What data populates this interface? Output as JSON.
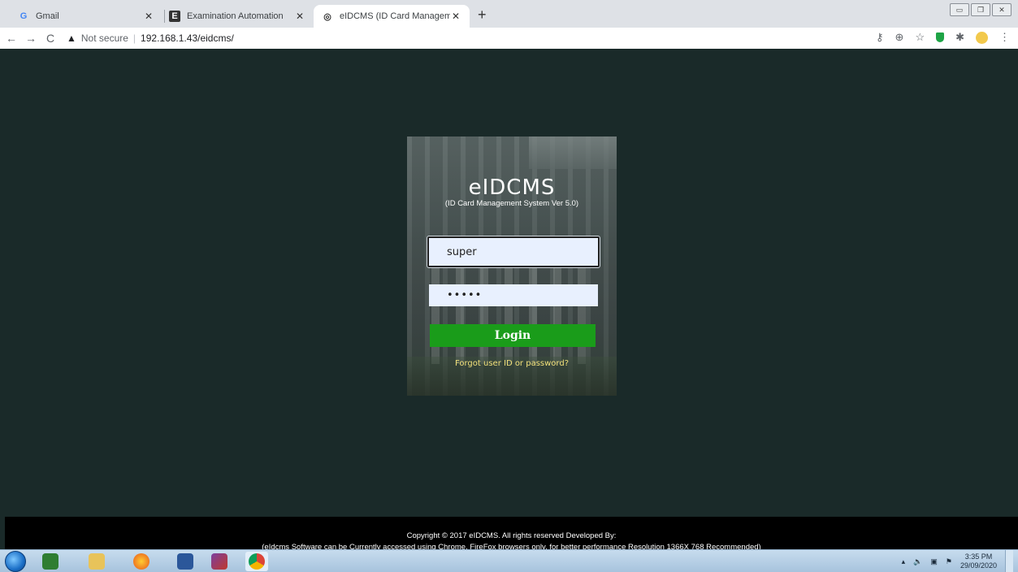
{
  "browser": {
    "tabs": [
      {
        "label": "Gmail",
        "icon": "gmail-icon",
        "icon_glyph": "G"
      },
      {
        "label": "Examination Automation",
        "icon": "app-icon",
        "icon_glyph": "E"
      },
      {
        "label": "eIDCMS (ID Card Management S",
        "icon": "globe-icon",
        "icon_glyph": "◎"
      }
    ],
    "new_tab": "+",
    "security_label": "Not secure",
    "url": "192.168.1.43/eidcms/"
  },
  "login": {
    "app_name": "eIDCMS",
    "subtitle": "(ID Card Management System Ver 5.0)",
    "username_value": "super",
    "password_mask": "•••••",
    "login_label": "Login",
    "forgot_label": "Forgot user ID or password?"
  },
  "footer": {
    "copyright": "Copyright © 2017 eIDCMS. All rights reserved Developed By:",
    "note": "(eIdcms Software can be Currently accessed using Chrome, FireFox browsers only. for better performance Resolution 1366X 768 Recommended)"
  },
  "taskbar": {
    "time": "3:35 PM",
    "date": "29/09/2020",
    "apps": [
      "excel-icon",
      "file-explorer-icon",
      "firefox-icon",
      "word-icon",
      "books-icon",
      "chrome-icon"
    ]
  },
  "colors": {
    "page_bg": "#1a2a29",
    "login_button": "#1a9c1a",
    "forgot_link": "#f1e07a",
    "input_bg": "#e8f0fe"
  }
}
